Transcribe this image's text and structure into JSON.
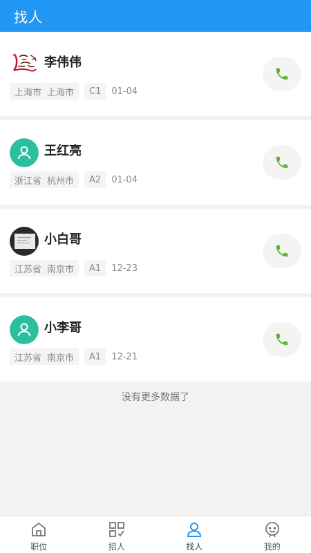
{
  "header": {
    "title": "找人"
  },
  "cards": [
    {
      "name": "李伟伟",
      "province": "上海市",
      "city": "上海市",
      "level": "C1",
      "date": "01-04",
      "avatar": "logo"
    },
    {
      "name": "王红亮",
      "province": "浙江省",
      "city": "杭州市",
      "level": "A2",
      "date": "01-04",
      "avatar": "default"
    },
    {
      "name": "小白哥",
      "province": "江苏省",
      "city": "南京市",
      "level": "A1",
      "date": "12-23",
      "avatar": "photo"
    },
    {
      "name": "小李哥",
      "province": "江苏省",
      "city": "南京市",
      "level": "A1",
      "date": "12-21",
      "avatar": "default"
    }
  ],
  "footer_message": "没有更多数据了",
  "tabs": [
    {
      "label": "职位",
      "icon": "home-icon",
      "active": false
    },
    {
      "label": "招人",
      "icon": "grid-icon",
      "active": false
    },
    {
      "label": "找人",
      "icon": "person-icon",
      "active": true
    },
    {
      "label": "我的",
      "icon": "face-icon",
      "active": false
    }
  ],
  "colors": {
    "accent": "#2196f3",
    "phone": "#5cb531",
    "avatar_bg": "#2bbfa0"
  }
}
